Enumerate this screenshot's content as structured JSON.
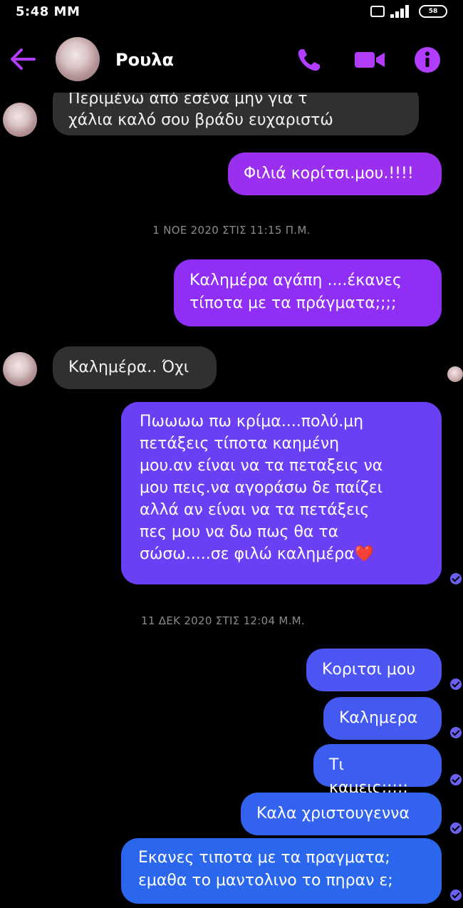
{
  "status": {
    "time": "5:48 MM",
    "battery": "58"
  },
  "header": {
    "name": "Ρουλα"
  },
  "colors": {
    "accent": "#b23cff",
    "incoming": "#303030"
  },
  "messages": [
    {
      "dir": "in",
      "text": "Περιμένω από εσένα μην για τ\nχάλια καλό σου βράδυ ευχαριστώ"
    },
    {
      "dir": "out",
      "text": "Φιλιά κορίτσι.μου.!!!!"
    },
    {
      "dir": "out",
      "text": "Καλημέρα αγάπη ....έκανες\nτίποτα με τα πράγματα;;;;"
    },
    {
      "dir": "in",
      "text": "Καλημέρα.. Όχι"
    },
    {
      "dir": "out",
      "text": "Πωωωω πω κρίμα....πολύ.μη\nπετάξεις τίποτα καημένη\nμου.αν είναι να τα πεταξεις να\nμου πεις.να αγοράσω δε παίζει\nαλλά αν είναι να τα πετάξεις\nπες μου να δω πως θα τα\nσώσω.....σε φιλώ καλημέρα❤️"
    },
    {
      "dir": "out",
      "text": "Κοριτσι μου"
    },
    {
      "dir": "out",
      "text": "Καλημερα"
    },
    {
      "dir": "out",
      "text": "Τι καμεις;;;;;"
    },
    {
      "dir": "out",
      "text": "Καλα χριστουγεννα"
    },
    {
      "dir": "out",
      "text": "Εκανες τιποτα με τα πραγματα;\nεμαθα το μαντολινο το πηραν ε;"
    }
  ],
  "timestamps": [
    "1 ΝΟΕ 2020 ΣΤΙΣ 11:15 Π.Μ.",
    "11 ΔΕΚ 2020 ΣΤΙΣ 12:04 Μ.Μ."
  ]
}
